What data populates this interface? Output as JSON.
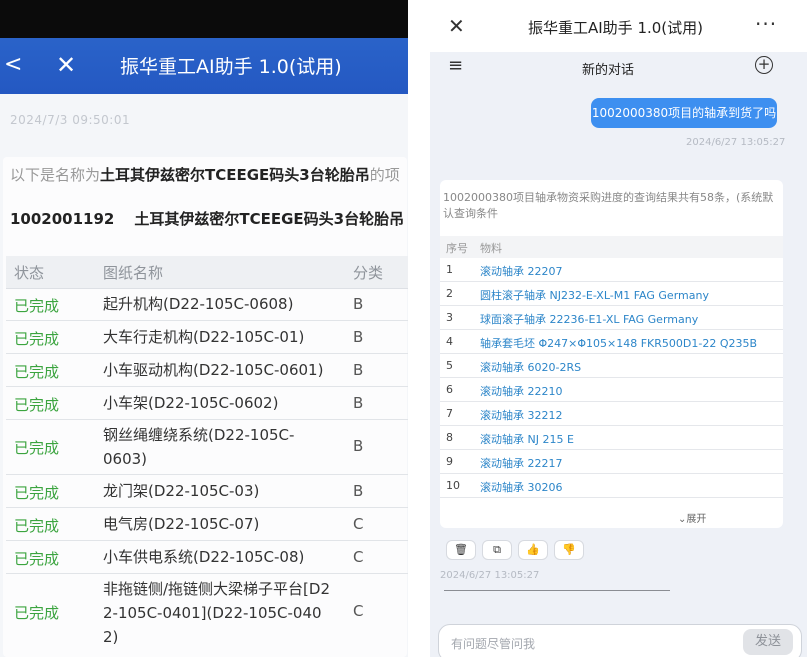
{
  "left": {
    "header": {
      "back_glyph": "<",
      "close_glyph": "✕",
      "title": "振华重工AI助手 1.0(试用)"
    },
    "timestamp": "2024/7/3 09:50:01",
    "intro_prefix": "以下是名称为",
    "intro_name": "土耳其伊兹密尔TCEEGE码头3台轮胎吊",
    "intro_suffix": "的项",
    "project_code": "1002001192",
    "project_name": "土耳其伊兹密尔TCEEGE码头3台轮胎吊",
    "table": {
      "headers": [
        "状态",
        "图纸名称",
        "分类"
      ],
      "rows": [
        {
          "status": "已完成",
          "name": "起升机构(D22-105C-0608)",
          "category": "B"
        },
        {
          "status": "已完成",
          "name": "大车行走机构(D22-105C-01)",
          "category": "B"
        },
        {
          "status": "已完成",
          "name": "小车驱动机构(D22-105C-0601)",
          "category": "B"
        },
        {
          "status": "已完成",
          "name": "小车架(D22-105C-0602)",
          "category": "B"
        },
        {
          "status": "已完成",
          "name": "钢丝绳缠绕系统(D22-105C-0603)",
          "category": "B"
        },
        {
          "status": "已完成",
          "name": "龙门架(D22-105C-03)",
          "category": "B"
        },
        {
          "status": "已完成",
          "name": "电气房(D22-105C-07)",
          "category": "C"
        },
        {
          "status": "已完成",
          "name": "小车供电系统(D22-105C-08)",
          "category": "C"
        },
        {
          "status": "已完成",
          "name": "非拖链侧/拖链侧大梁梯子平台[D22-105C-0401](D22-105C-0402)",
          "category": "C"
        }
      ]
    },
    "status_color": "#3ba43f",
    "header_color": "#2a63c9"
  },
  "right": {
    "topbar": {
      "close_glyph": "✕",
      "title": "振华重工AI助手 1.0(试用)",
      "more_glyph": "···"
    },
    "subbar": {
      "menu_glyph": "≡",
      "title": "新的对话",
      "plus_glyph": "+"
    },
    "user_message": "1002000380项目的轴承到货了吗",
    "user_timestamp": "2024/6/27 13:05:27",
    "answer": {
      "summary": "1002000380项目轴承物资采购进度的查询结果共有58条，(系统默认查询条件",
      "headers": [
        "序号",
        "物料"
      ],
      "rows": [
        {
          "no": "1",
          "material": "滚动轴承 22207"
        },
        {
          "no": "2",
          "material": "圆柱滚子轴承 NJ232-E-XL-M1 FAG Germany"
        },
        {
          "no": "3",
          "material": "球面滚子轴承 22236-E1-XL FAG Germany"
        },
        {
          "no": "4",
          "material": "轴承套毛坯 Φ247×Φ105×148 FKR500D1-22 Q235B"
        },
        {
          "no": "5",
          "material": "滚动轴承 6020-2RS"
        },
        {
          "no": "6",
          "material": "滚动轴承 22210"
        },
        {
          "no": "7",
          "material": "滚动轴承 32212"
        },
        {
          "no": "8",
          "material": "滚动轴承 NJ 215 E"
        },
        {
          "no": "9",
          "material": "滚动轴承 22217"
        },
        {
          "no": "10",
          "material": "滚动轴承 30206"
        }
      ],
      "expand_label": "⌄展开"
    },
    "actions": [
      {
        "icon": "trash-icon",
        "glyph": "🗑"
      },
      {
        "icon": "copy-icon",
        "glyph": "⧉"
      },
      {
        "icon": "thumbs-up-icon",
        "glyph": "👍"
      },
      {
        "icon": "thumbs-down-icon",
        "glyph": "👎"
      }
    ],
    "answer_timestamp": "2024/6/27 13:05:27",
    "input_placeholder": "有问题尽管问我",
    "send_label": "发送",
    "bubble_color": "#3d8ff0",
    "link_color": "#2d86c9"
  }
}
